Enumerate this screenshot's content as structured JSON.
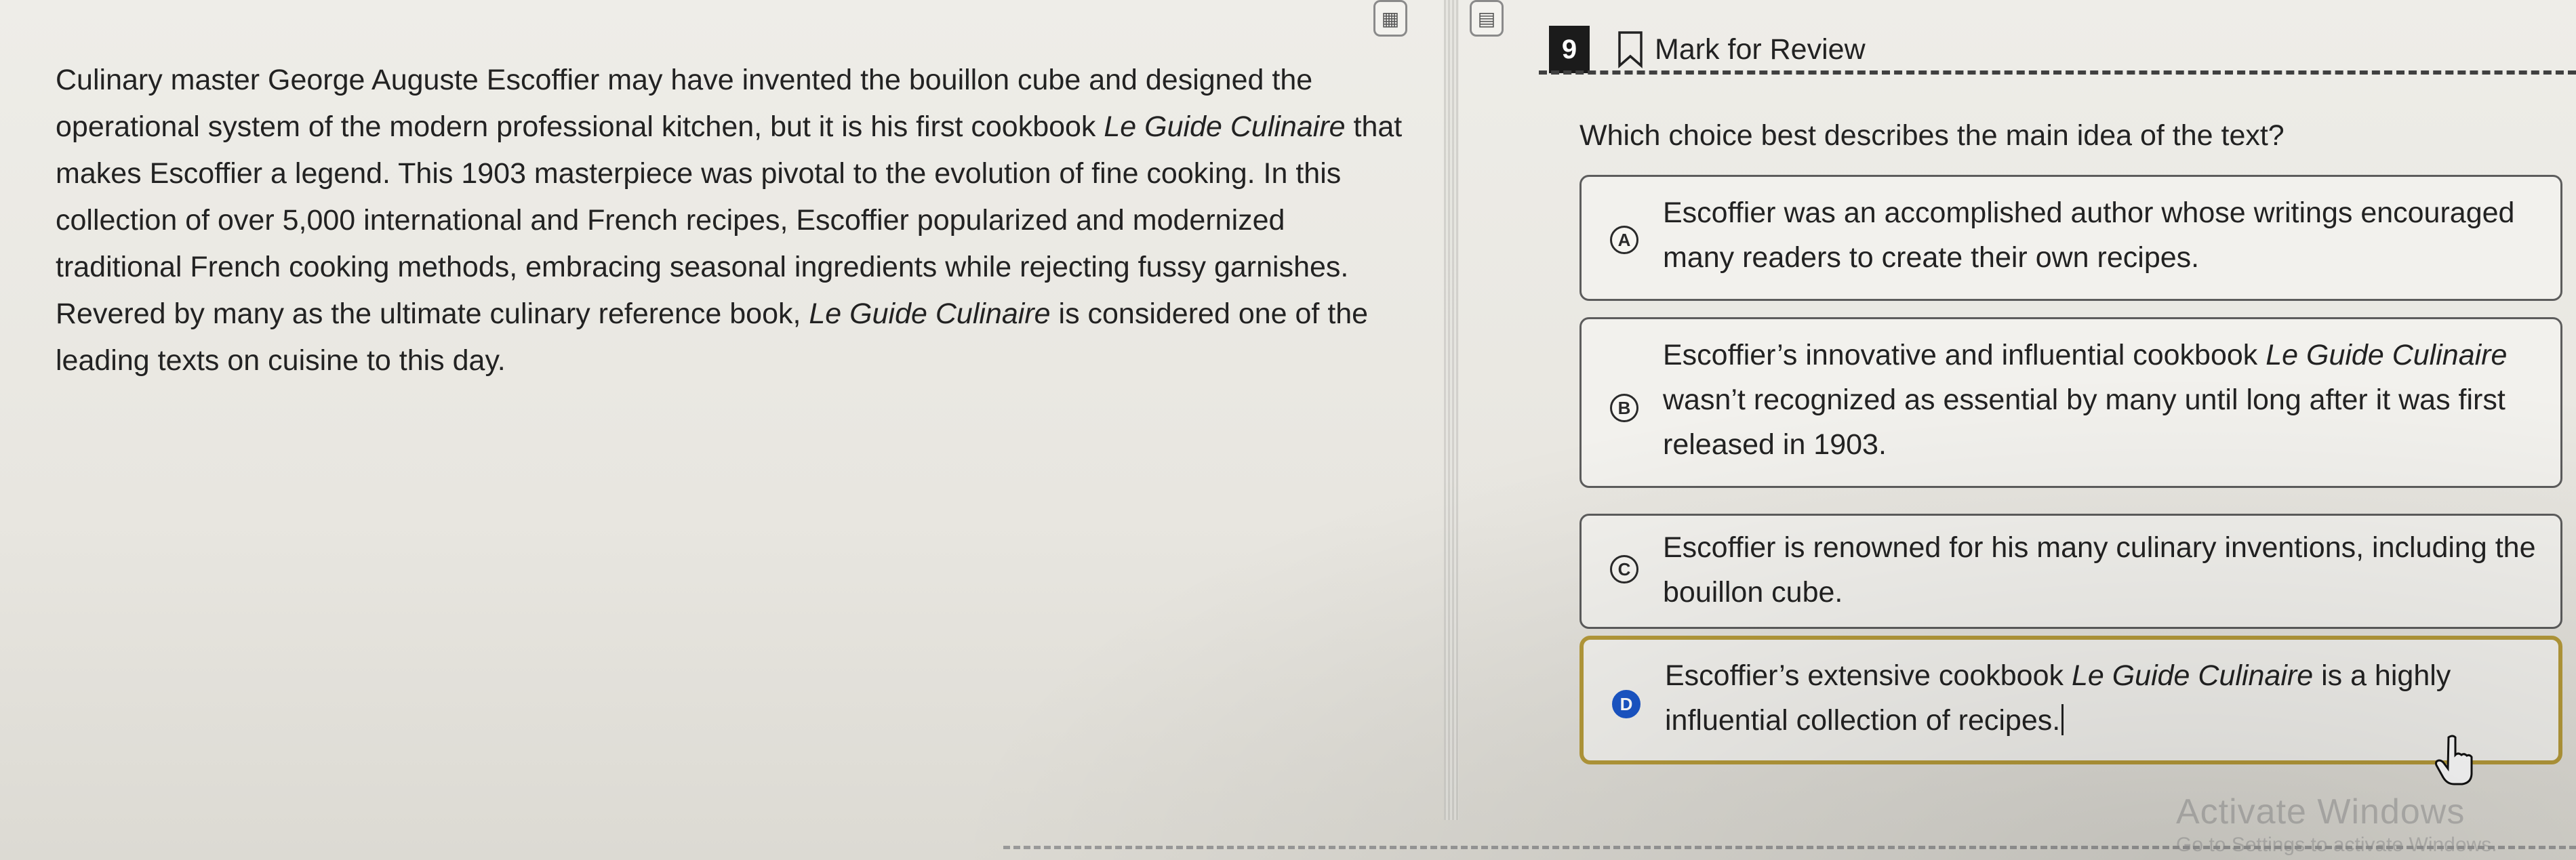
{
  "toolbar": {
    "left_control_icon": "calculator-icon",
    "right_control_icon": "reference-sheet-icon"
  },
  "passage": {
    "sentence1": "Culinary master George Auguste Escoffier may have invented the bouillon cube and designed the operational system of the modern professional kitchen, but it is his first cookbook ",
    "book_title": "Le Guide Culinaire",
    "sentence2": " that makes Escoffier a legend. This 1903 masterpiece was pivotal to the evolution of fine cooking. In this collection of over 5,000 international and French recipes, Escoffier popularized and modernized traditional French cooking methods, embracing seasonal ingredients while rejecting fussy garnishes. Revered by many as the ultimate culinary reference book, ",
    "sentence3": " is considered one of the leading texts on cuisine to this day."
  },
  "question_header": {
    "number": "9",
    "mark_label": "Mark for Review"
  },
  "question": {
    "prompt": "Which choice best describes the main idea of the text?"
  },
  "choices": [
    {
      "letter": "A",
      "text": "Escoffier was an accomplished author whose writings encouraged many readers to create their own recipes."
    },
    {
      "letter": "B",
      "text_pre": "Escoffier’s innovative and influential cookbook ",
      "text_em": "Le Guide Culinaire",
      "text_post": " wasn’t recognized as essential by many until long after it was first released in 1903."
    },
    {
      "letter": "C",
      "text": "Escoffier is renowned for his many culinary inventions, including the bouillon cube."
    },
    {
      "letter": "D",
      "text_pre": "Escoffier’s extensive cookbook ",
      "text_em": "Le Guide Culinaire",
      "text_post": " is a highly influential collection of recipes.",
      "selected": true
    }
  ],
  "watermark": {
    "title": "Activate Windows",
    "subtitle": "Go to Settings to activate Windows."
  },
  "colors": {
    "selected_border": "#b59a3a",
    "selected_letter": "#1a56c8"
  }
}
